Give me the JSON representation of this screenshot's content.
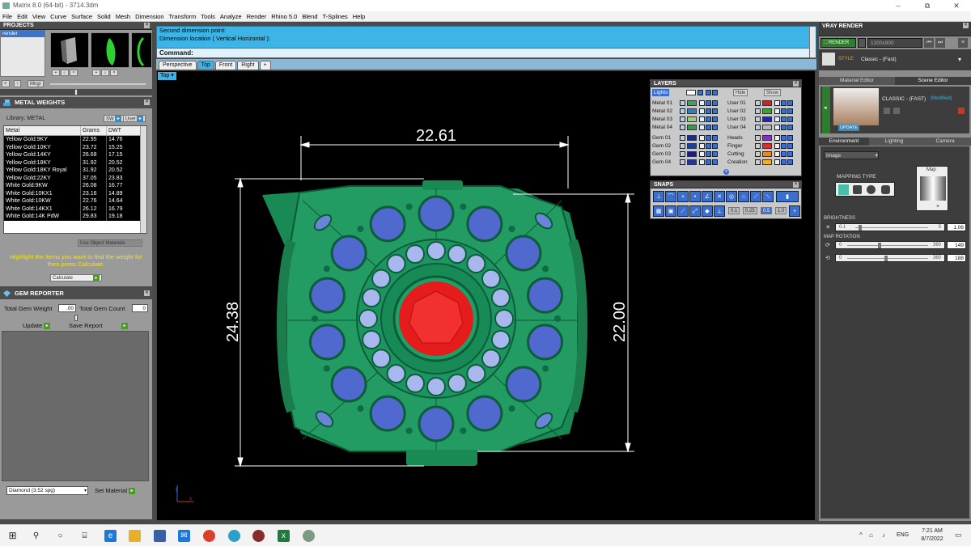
{
  "window": {
    "title": "Matrix 8.0 (64-bit) - 3714.3dm",
    "minimize": "–",
    "maximize": "⧉",
    "close": "✕"
  },
  "menu": [
    "File",
    "Edit",
    "View",
    "Curve",
    "Surface",
    "Solid",
    "Mesh",
    "Dimension",
    "Transform",
    "Tools",
    "Analyze",
    "Render",
    "Rhino 5.0",
    "Blend",
    "T-Splines",
    "Help"
  ],
  "projects": {
    "title": "PROJECTS",
    "items": [
      "render"
    ],
    "thumbs": [
      "1",
      "2",
      "3"
    ],
    "mngr_label": "Mngr"
  },
  "metal_weights": {
    "title": "METAL WEIGHTS",
    "library_label": "Library: METAL",
    "sw_label": "SW",
    "user_label": "User",
    "columns": [
      "Metal",
      "Grams",
      "DWT"
    ],
    "rows": [
      [
        "Yellow Gold:9KY",
        "22.95",
        "14.76"
      ],
      [
        "Yellow Gold:10KY",
        "23.72",
        "15.25"
      ],
      [
        "Yellow Gold:14KY",
        "26.68",
        "17.15"
      ],
      [
        "Yellow Gold:18KY",
        "31.92",
        "20.52"
      ],
      [
        "Yellow Gold:18KY Royal",
        "31.92",
        "20.52"
      ],
      [
        "Yellow Gold:22KY",
        "37.05",
        "23.83"
      ],
      [
        "White Gold:9KW",
        "26.08",
        "16.77"
      ],
      [
        "White Gold:10KX1",
        "23.16",
        "14.89"
      ],
      [
        "White Gold:10KW",
        "22.76",
        "14.64"
      ],
      [
        "White Gold:14KX1",
        "26.12",
        "16.79"
      ],
      [
        "White Gold:14K PdW",
        "29.83",
        "19.18"
      ]
    ],
    "use_object_materials": "Use Object Materials",
    "hint": "Highlight the items you want to find the weight for then press Calculate.",
    "calculate": "Calculate"
  },
  "gem_reporter": {
    "title": "GEM REPORTER",
    "total_weight_label": "Total Gem Weight",
    "total_weight_value": ".00",
    "total_count_label": "Total Gem Count",
    "total_count_value": "0",
    "update": "Update",
    "save_report": "Save Report",
    "material_value": "Diamond    (3.52 spg)",
    "set_material": "Set Material"
  },
  "command": {
    "line1": "Second dimension point:",
    "line2": "Dimension location ( Vertical  Horizontal ):",
    "prompt": "Command:"
  },
  "viewport_tabs": [
    "Perspective",
    "Top",
    "Front",
    "Right",
    "+"
  ],
  "active_tab": "Top",
  "viewport": {
    "label": "Top",
    "dim_width": "22.61",
    "dim_left": "24.38",
    "dim_right": "22.00",
    "axis_y": "y",
    "axis_x": "x"
  },
  "layers": {
    "title": "LAYERS",
    "lights": "Lights",
    "hide": "Hide",
    "show": "Show",
    "left": [
      {
        "name": "Metal 01",
        "color": "#3aa55a"
      },
      {
        "name": "Metal 02",
        "color": "#2f7fbf"
      },
      {
        "name": "Metal 03",
        "color": "#9ad16e"
      },
      {
        "name": "Metal 04",
        "color": "#2e9e3e"
      },
      {
        "name": "Gem 01",
        "color": "#1a2b8c"
      },
      {
        "name": "Gem 02",
        "color": "#1d3fa0"
      },
      {
        "name": "Gem 03",
        "color": "#1a1a8a"
      },
      {
        "name": "Gem 04",
        "color": "#26359c"
      }
    ],
    "right": [
      {
        "name": "User 01",
        "color": "#e21b1b"
      },
      {
        "name": "User 02",
        "color": "#1fb51f"
      },
      {
        "name": "User 03",
        "color": "#1a22d8"
      },
      {
        "name": "User 04",
        "color": "#b8b8b8"
      },
      {
        "name": "Heads",
        "color": "#8a2fbf"
      },
      {
        "name": "Finger",
        "color": "#d83030"
      },
      {
        "name": "Cutting",
        "color": "#e88a1a"
      },
      {
        "name": "Creation",
        "color": "#f0b020"
      }
    ]
  },
  "snaps": {
    "title": "SNAPS",
    "values": [
      "0.1",
      "0.25",
      "0.5",
      "1.0"
    ]
  },
  "vray": {
    "title": "VRAY RENDER",
    "render_btn": "RENDER",
    "resolution": "1200x900",
    "style_label": "STYLE",
    "style_value": "Classic - (Fast)",
    "tab_material": "Material Editor",
    "tab_scene": "Scene Editor",
    "preset_name": "CLASSIC - (FAST)",
    "preset_state": "(Modified)",
    "update": "UPDATE",
    "env_tabs": [
      "Environment",
      "Lighting",
      "Camera"
    ],
    "image_select": "Image",
    "mapping_type": "MAPPING TYPE",
    "map_label": "Map",
    "brightness_label": "BRIGHTNESS",
    "brightness_min": "0.1",
    "brightness_max": "5",
    "brightness_value": "1.06",
    "map_rotation_label": "MAP ROTATION",
    "rot1_min": "0",
    "rot1_max": "360",
    "rot1_value": "149",
    "rot2_min": "0",
    "rot2_max": "360",
    "rot2_value": "188"
  },
  "taskbar": {
    "language": "ENG",
    "time": "7:21 AM",
    "date": "8/7/2022"
  }
}
